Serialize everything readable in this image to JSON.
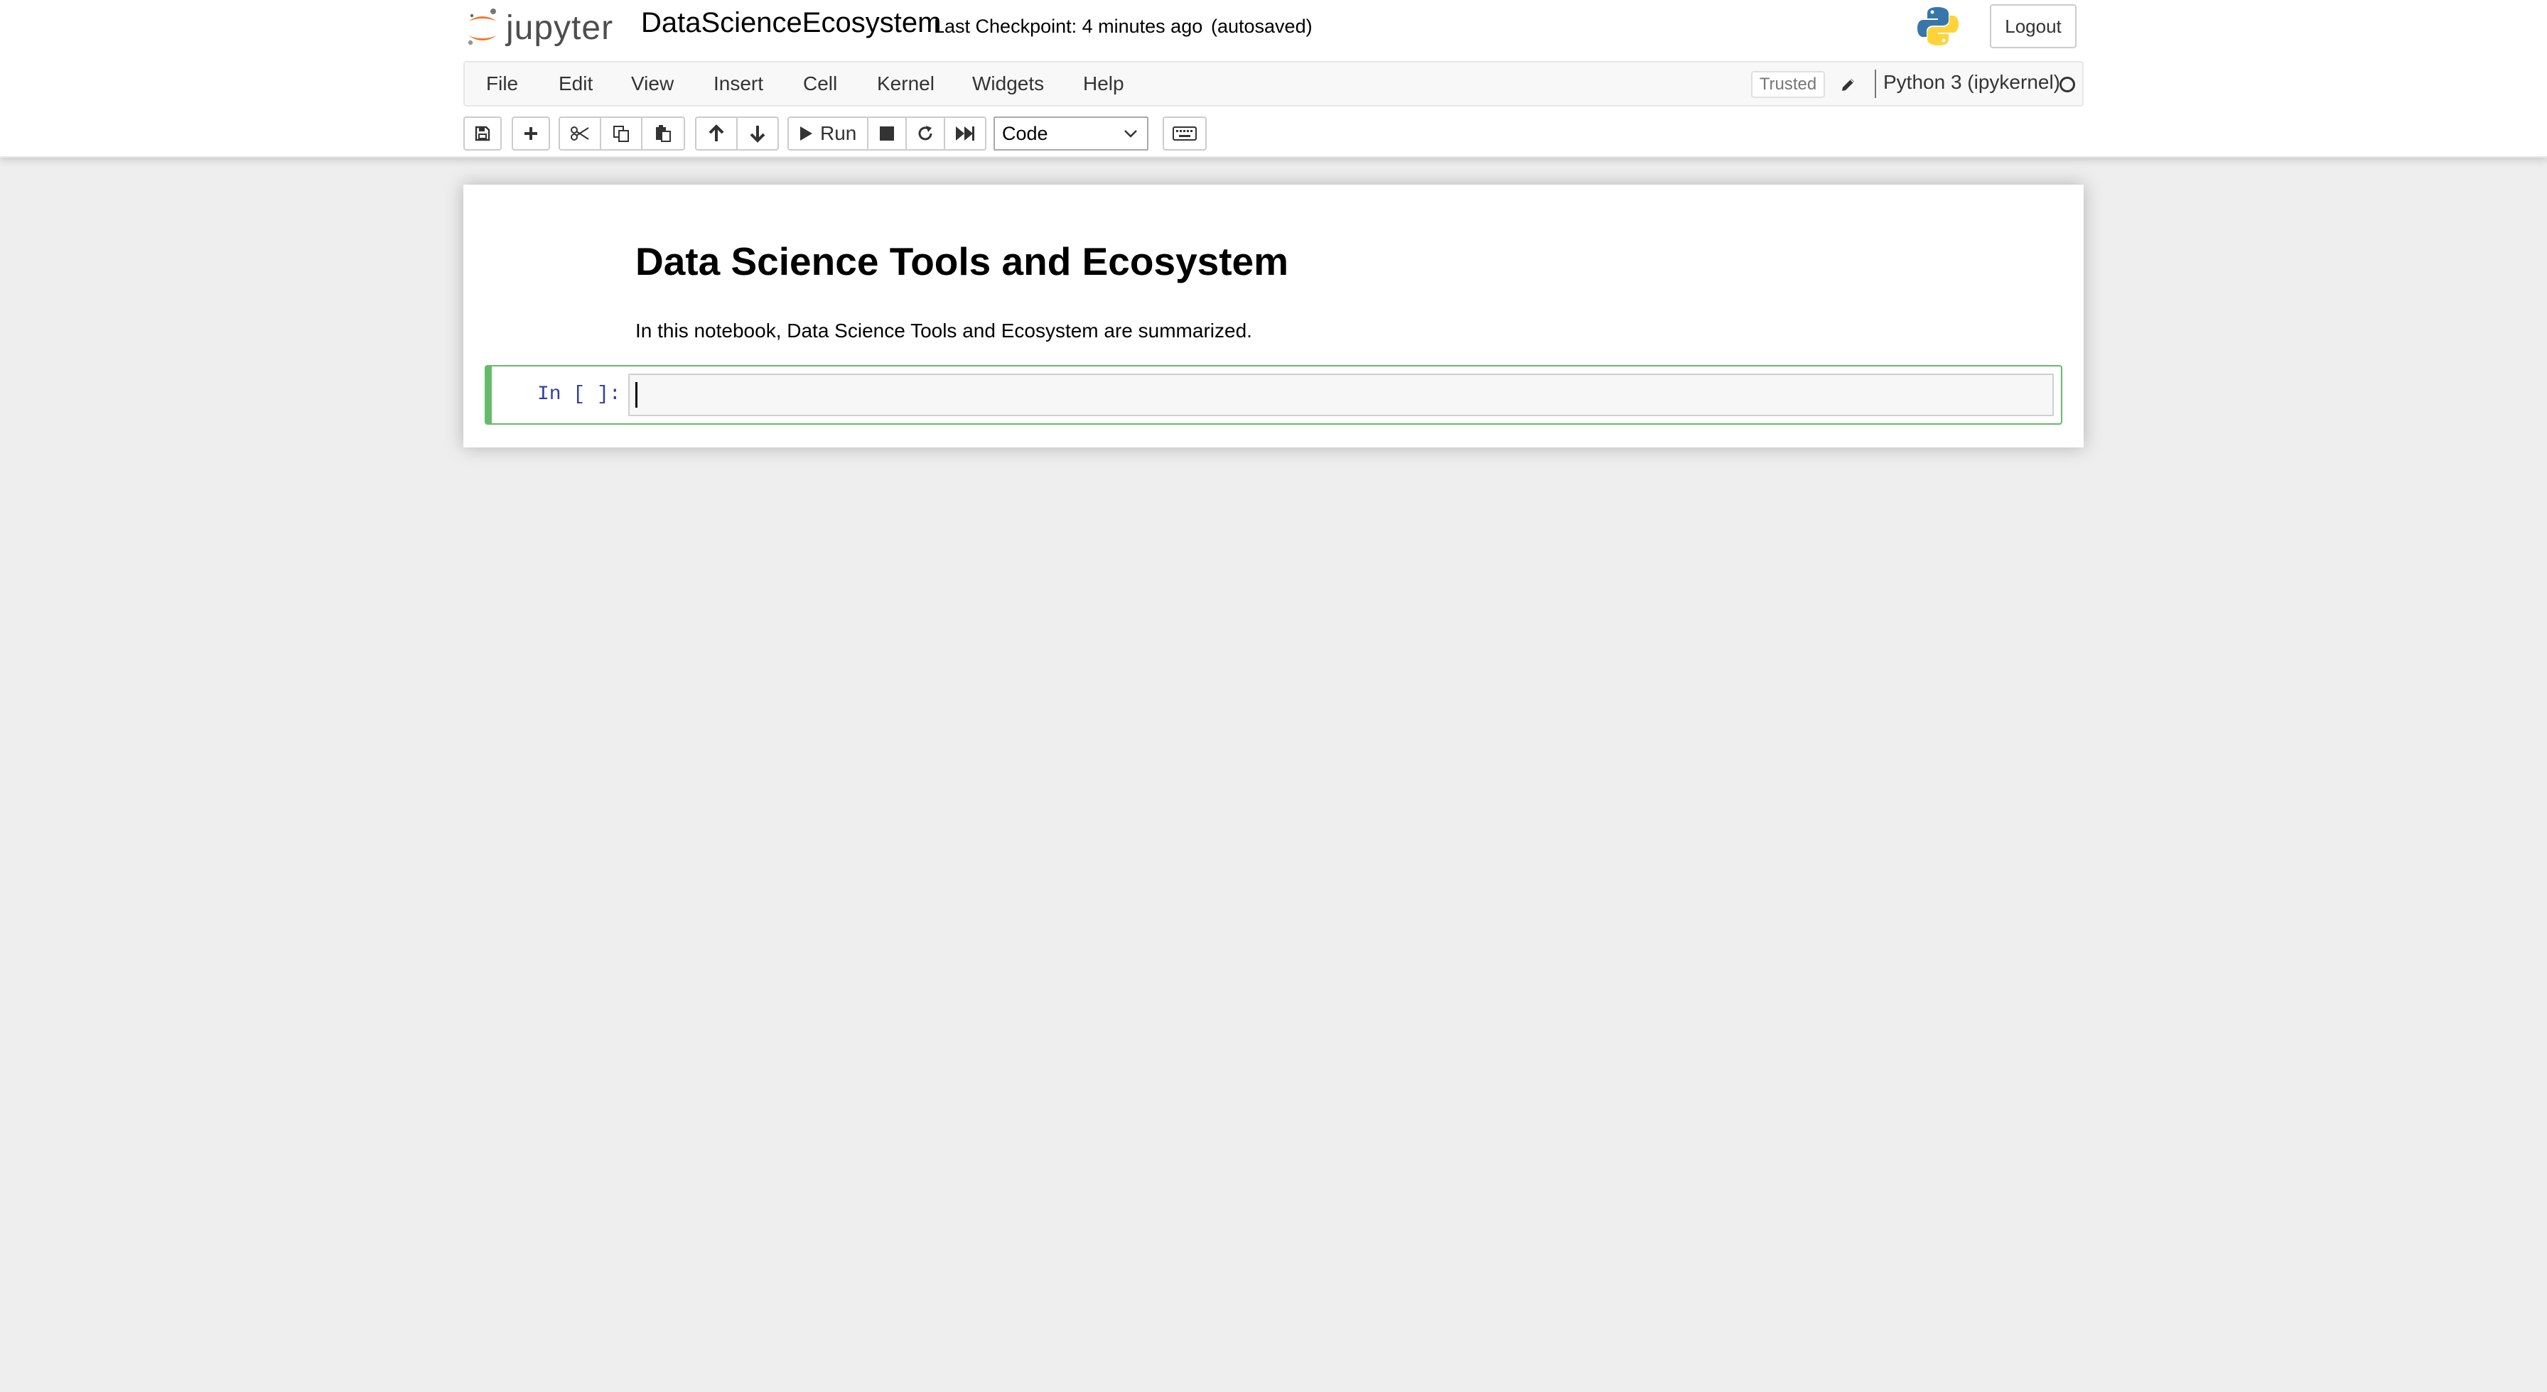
{
  "header": {
    "logo_text": "jupyter",
    "notebook_title": "DataScienceEcosystem",
    "checkpoint": "Last Checkpoint: 4 minutes ago",
    "autosave": "(autosaved)",
    "logout_label": "Logout"
  },
  "menubar": {
    "items": [
      "File",
      "Edit",
      "View",
      "Insert",
      "Cell",
      "Kernel",
      "Widgets",
      "Help"
    ],
    "trusted_label": "Trusted",
    "kernel_name": "Python 3 (ipykernel)"
  },
  "toolbar": {
    "run_label": "Run",
    "cell_type": "Code",
    "icons": [
      "save-icon",
      "plus-icon",
      "cut-icon",
      "copy-icon",
      "paste-icon",
      "arrow-up-icon",
      "arrow-down-icon",
      "run-icon",
      "stop-icon",
      "restart-icon",
      "fast-forward-icon",
      "keyboard-icon"
    ]
  },
  "notebook": {
    "heading": "Data Science Tools and Ecosystem",
    "paragraph": "In this notebook, Data Science Tools and Ecosystem are summarized.",
    "code_prompt": "In [ ]:",
    "code_value": ""
  },
  "colors": {
    "active_cell_border": "#66bb6a",
    "prompt_color": "#303f9f",
    "logo_orange": "#f37726"
  }
}
